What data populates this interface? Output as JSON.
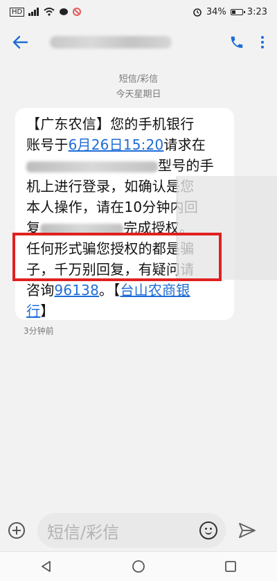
{
  "status": {
    "left_tags": [
      "HD"
    ],
    "battery": "34%",
    "time": "3:23"
  },
  "header": {
    "contact_blurred": true
  },
  "thread": {
    "type": "短信/彩信",
    "date": "今天星期日"
  },
  "message": {
    "lines": [
      {
        "parts": [
          {
            "t": "【广东农信】您的手机银行"
          }
        ]
      },
      {
        "parts": [
          {
            "t": "账号于"
          },
          {
            "t": "6月26日15:20",
            "link": true
          },
          {
            "t": "请求在"
          }
        ]
      },
      {
        "parts": [
          {
            "blur": 190
          },
          {
            "t": "型号的手"
          }
        ]
      },
      {
        "parts": [
          {
            "t": "机上进行登录，如确认是您"
          }
        ]
      },
      {
        "parts": [
          {
            "t": "本人操作，请在10分钟内回"
          }
        ]
      },
      {
        "parts": [
          {
            "t": "复"
          },
          {
            "blur": 120
          },
          {
            "t": "完成授权。"
          }
        ]
      },
      {
        "parts": [
          {
            "t": "任何形式骗您授权的都是骗"
          }
        ]
      },
      {
        "parts": [
          {
            "t": "子，千万别回复，有疑问请"
          }
        ]
      },
      {
        "parts": [
          {
            "t": "咨询"
          },
          {
            "t": "96138",
            "link": true
          },
          {
            "t": "。"
          },
          {
            "t": "【"
          },
          {
            "t": "台山农商银",
            "link": true
          }
        ]
      },
      {
        "parts": [
          {
            "t": "行",
            "link": true
          },
          {
            "t": "】"
          }
        ]
      }
    ],
    "time_ago": "3分钟前"
  },
  "composer": {
    "placeholder": "短信/彩信"
  },
  "colors": {
    "accent": "#1e6cd6",
    "highlight": "#e02020"
  }
}
